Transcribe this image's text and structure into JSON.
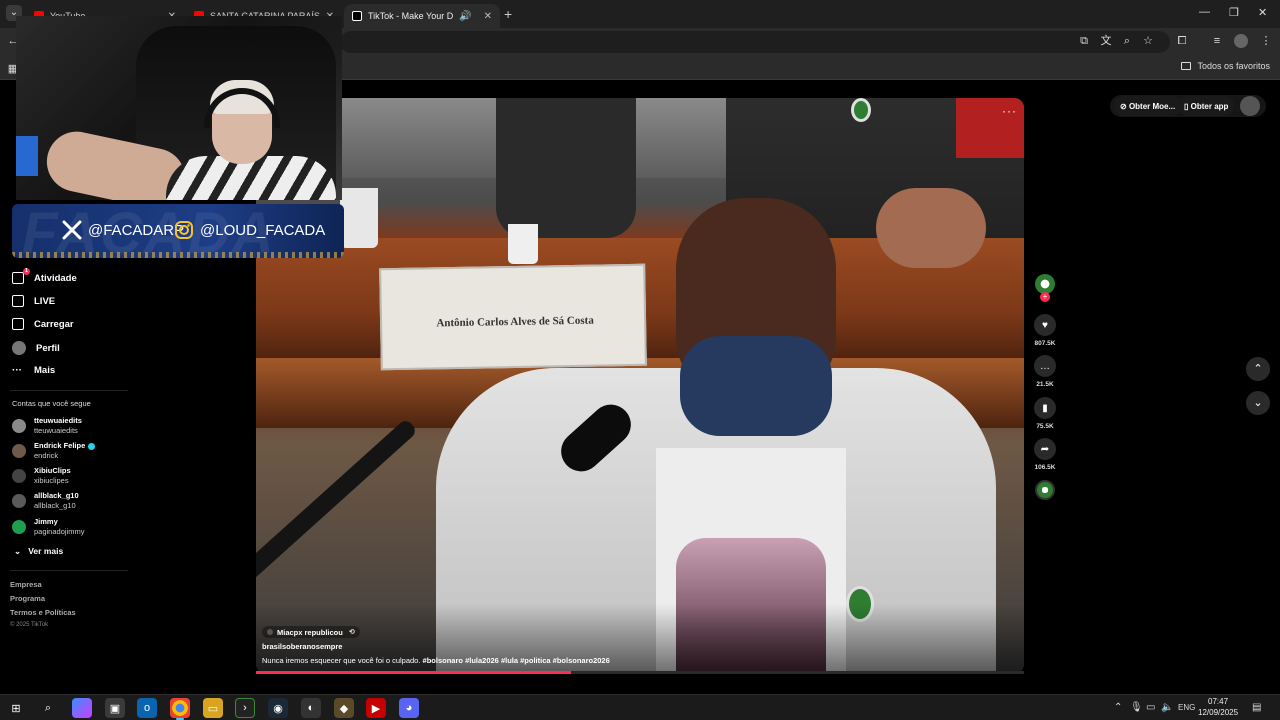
{
  "browser": {
    "tabs": [
      {
        "label": "YouTube",
        "color": "#ff0000"
      },
      {
        "label": "SANTA CATARINA PARAÍSO DA",
        "color": "#ff0000"
      },
      {
        "label": "TikTok - Make Your Day",
        "color": "#ffffff"
      }
    ],
    "bookmarks_folder": "Todos os favoritos"
  },
  "overlay": {
    "brand_bg": "FACADA",
    "twitter_handle": "@FACADARP",
    "instagram_handle": "@LOUD_FACADA"
  },
  "sidebar": {
    "nav": [
      {
        "label": "Atividade",
        "icon": "inbox-icon",
        "badge": "1"
      },
      {
        "label": "LIVE",
        "icon": "live-icon"
      },
      {
        "label": "Carregar",
        "icon": "upload-icon"
      },
      {
        "label": "Perfil",
        "icon": "profile-avatar"
      },
      {
        "label": "Mais",
        "icon": "more-icon"
      }
    ],
    "following_title": "Contas que você segue",
    "following": [
      {
        "name": "tteuwuaiedits",
        "user": "tteuwuaiedits",
        "color": "#8a8a8a"
      },
      {
        "name": "Endrick Felipe",
        "user": "endrick",
        "color": "#6d5a4a",
        "verified": true
      },
      {
        "name": "XibiuClips",
        "user": "xibiuclipes",
        "color": "#444444"
      },
      {
        "name": "allblack_g10",
        "user": "allblack_g10",
        "color": "#5a5a5a"
      },
      {
        "name": "Jimmy",
        "user": "paginadojimmy",
        "color": "#1f9e4f"
      }
    ],
    "see_more": "Ver mais",
    "footer": [
      "Empresa",
      "Programa",
      "Termos e Políticas"
    ],
    "copyright": "© 2025 TikTok"
  },
  "topright": {
    "coins": "Obter Moe...",
    "app": "Obter app"
  },
  "video": {
    "nameplate": "Antônio Carlos Alves de Sá Costa",
    "reposted_by": "Miacpx republicou",
    "author": "brasilsoberanosempre",
    "caption_text": "Nunca iremos esquecer que você foi o culpado.",
    "hashtags": [
      "#bolsonaro",
      "#lula2026",
      "#lula",
      "#politica",
      "#bolsonaro2026"
    ],
    "progress": 0.41
  },
  "actions": {
    "likes": "807.5K",
    "comments": "21.5K",
    "saves": "75.5K",
    "shares": "106.5K"
  },
  "taskbar": {
    "lang": "ENG",
    "time": "07:47",
    "date": "12/09/2025"
  }
}
